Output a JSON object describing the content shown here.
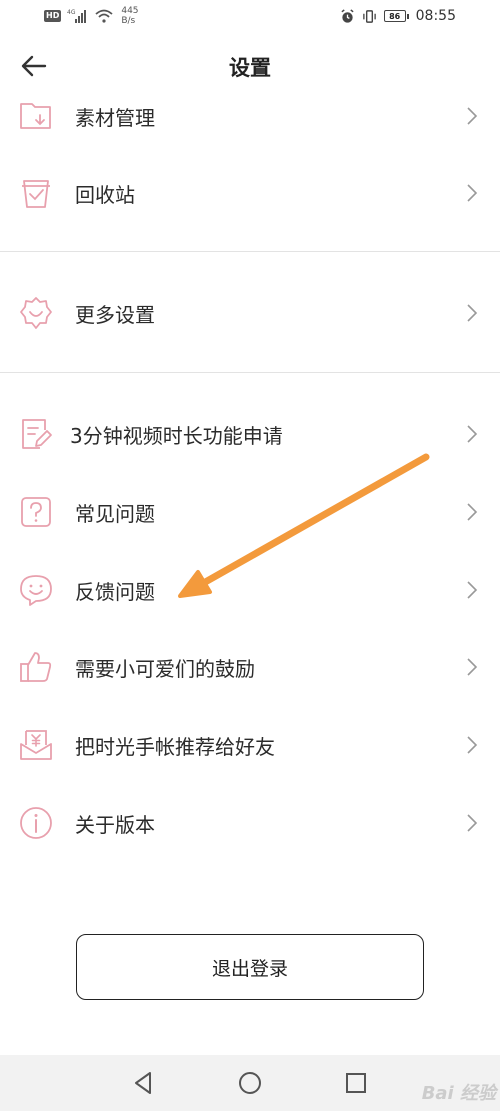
{
  "status_bar": {
    "hd": "HD",
    "network": "4G",
    "speed_value": "445",
    "speed_unit": "B/s",
    "battery": "86",
    "time": "08:55"
  },
  "header": {
    "title": "设置",
    "back_icon": "arrow-left-icon"
  },
  "menu": {
    "items": [
      {
        "label": "素材管理",
        "icon": "folder-download-icon"
      },
      {
        "label": "回收站",
        "icon": "trash-icon"
      },
      {
        "label": "更多设置",
        "icon": "gear-icon"
      },
      {
        "label": "3分钟视频时长功能申请",
        "icon": "edit-document-icon"
      },
      {
        "label": "常见问题",
        "icon": "question-icon"
      },
      {
        "label": "反馈问题",
        "icon": "smile-chat-icon"
      },
      {
        "label": "需要小可爱们的鼓励",
        "icon": "thumbs-up-icon"
      },
      {
        "label": "把时光手帐推荐给好友",
        "icon": "yuan-share-icon"
      },
      {
        "label": "关于版本",
        "icon": "info-icon"
      }
    ]
  },
  "logout_label": "退出登录",
  "annotation": {
    "color": "#f39a3c"
  },
  "colors": {
    "icon_accent": "#e8a0ad"
  },
  "watermark": "Bai 经验"
}
